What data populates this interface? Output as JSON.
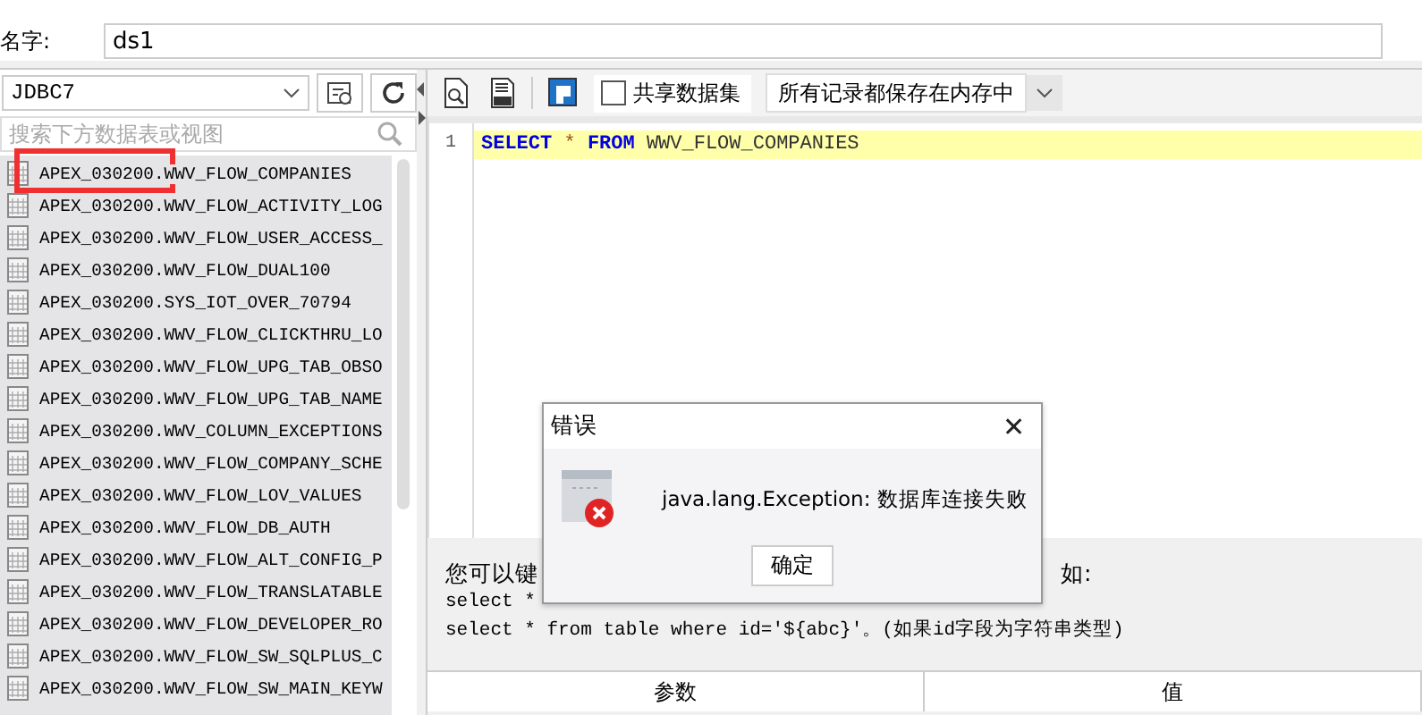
{
  "name_field": {
    "label": "名字:",
    "value": "ds1"
  },
  "datasource": {
    "value": "JDBC7"
  },
  "search": {
    "placeholder": "搜索下方数据表或视图"
  },
  "tables": [
    "APEX_030200.WWV_FLOW_COMPANIES",
    "APEX_030200.WWV_FLOW_ACTIVITY_LOG",
    "APEX_030200.WWV_FLOW_USER_ACCESS_",
    "APEX_030200.WWV_FLOW_DUAL100",
    "APEX_030200.SYS_IOT_OVER_70794",
    "APEX_030200.WWV_FLOW_CLICKTHRU_LO",
    "APEX_030200.WWV_FLOW_UPG_TAB_OBSO",
    "APEX_030200.WWV_FLOW_UPG_TAB_NAME",
    "APEX_030200.WWV_COLUMN_EXCEPTIONS",
    "APEX_030200.WWV_FLOW_COMPANY_SCHE",
    "APEX_030200.WWV_FLOW_LOV_VALUES",
    "APEX_030200.WWV_FLOW_DB_AUTH",
    "APEX_030200.WWV_FLOW_ALT_CONFIG_P",
    "APEX_030200.WWV_FLOW_TRANSLATABLE",
    "APEX_030200.WWV_FLOW_DEVELOPER_RO",
    "APEX_030200.WWV_FLOW_SW_SQLPLUS_C",
    "APEX_030200.WWV_FLOW_SW_MAIN_KEYW"
  ],
  "share_checkbox": {
    "label": "共享数据集",
    "checked": false
  },
  "mode_select": {
    "value": "所有记录都保存在内存中"
  },
  "editor_lines": [
    {
      "number": "1",
      "current": true,
      "tokens": [
        {
          "kind": "keyword",
          "text": "SELECT"
        },
        {
          "kind": "operator",
          "text": "*"
        },
        {
          "kind": "keyword",
          "text": "FROM"
        },
        {
          "kind": "name",
          "text": "WWV_FLOW_COMPANIES"
        }
      ]
    }
  ],
  "hint": {
    "line_1_start": "您可以键",
    "line_1_end": "如:",
    "line_2": "select *",
    "line_3": "select * from table where id='${abc}'。(如果id字段为字符串类型)"
  },
  "params_table": {
    "columns": [
      "参数",
      "值"
    ]
  },
  "dialog": {
    "title": "错误",
    "close": "✕",
    "message": "java.lang.Exception: 数据库连接失败",
    "button": "确定"
  }
}
